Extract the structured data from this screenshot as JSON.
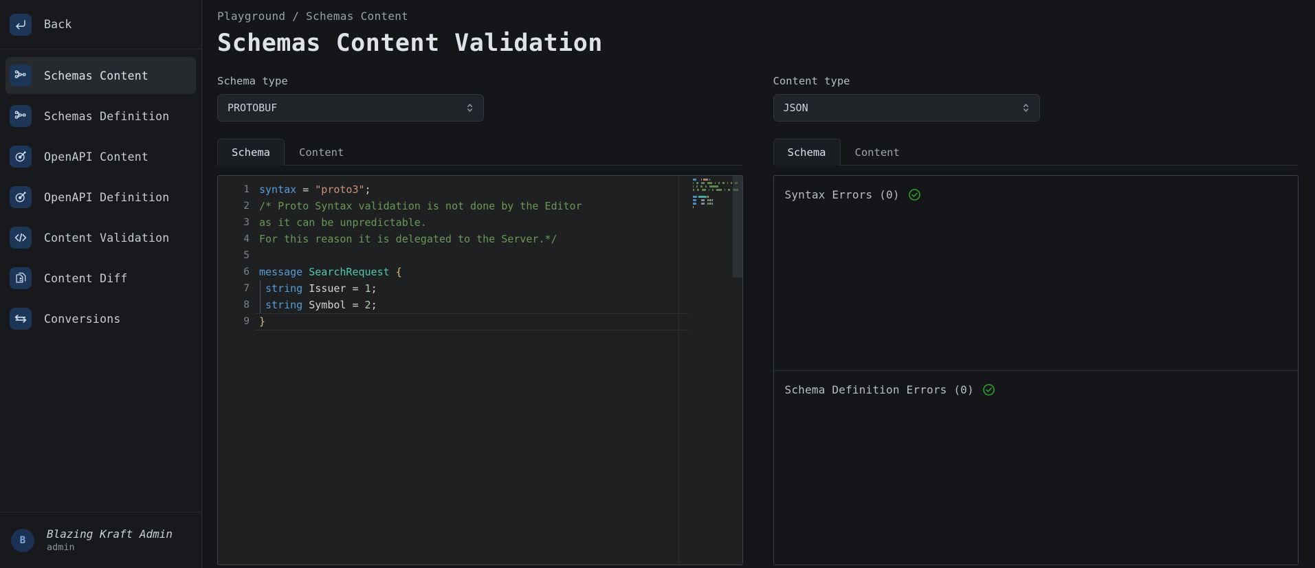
{
  "sidebar": {
    "back": {
      "label": "Back",
      "icon": "back-arrow-icon"
    },
    "items": [
      {
        "label": "Schemas Content",
        "icon": "schema-node-icon",
        "active": true
      },
      {
        "label": "Schemas Definition",
        "icon": "schema-node-icon",
        "active": false
      },
      {
        "label": "OpenAPI Content",
        "icon": "openapi-icon",
        "active": false
      },
      {
        "label": "OpenAPI Definition",
        "icon": "openapi-icon",
        "active": false
      },
      {
        "label": "Content Validation",
        "icon": "code-brackets-icon",
        "active": false
      },
      {
        "label": "Content Diff",
        "icon": "document-diff-icon",
        "active": false
      },
      {
        "label": "Conversions",
        "icon": "swap-arrows-icon",
        "active": false
      }
    ],
    "user": {
      "initial": "B",
      "name": "Blazing Kraft Admin",
      "role": "admin"
    }
  },
  "header": {
    "breadcrumb": "Playground / Schemas Content",
    "title": "Schemas Content Validation"
  },
  "left": {
    "select_label": "Schema type",
    "select_value": "PROTOBUF",
    "tabs": [
      {
        "label": "Schema",
        "active": true
      },
      {
        "label": "Content",
        "active": false
      }
    ],
    "editor": {
      "language": "protobuf",
      "lines": [
        {
          "n": "1",
          "tokens": [
            {
              "t": "syntax",
              "c": "tok-key"
            },
            {
              "t": " = ",
              "c": "tok-plain"
            },
            {
              "t": "\"proto3\"",
              "c": "tok-str"
            },
            {
              "t": ";",
              "c": "tok-plain"
            }
          ]
        },
        {
          "n": "2",
          "tokens": [
            {
              "t": "/* Proto Syntax validation is not done by the Editor",
              "c": "tok-cmt"
            }
          ]
        },
        {
          "n": "3",
          "tokens": [
            {
              "t": "as it can be unpredictable.",
              "c": "tok-cmt"
            }
          ]
        },
        {
          "n": "4",
          "tokens": [
            {
              "t": "For this reason it is delegated to the Server.*/",
              "c": "tok-cmt"
            }
          ]
        },
        {
          "n": "5",
          "tokens": [
            {
              "t": "",
              "c": "tok-plain"
            }
          ]
        },
        {
          "n": "6",
          "tokens": [
            {
              "t": "message ",
              "c": "tok-key"
            },
            {
              "t": "SearchRequest",
              "c": "tok-cls"
            },
            {
              "t": " ",
              "c": "tok-plain"
            },
            {
              "t": "{",
              "c": "tok-brace"
            }
          ]
        },
        {
          "n": "7",
          "tokens": [
            {
              "t": " ",
              "c": "tok-plain"
            },
            {
              "t": "string",
              "c": "tok-key"
            },
            {
              "t": " Issuer = ",
              "c": "tok-plain"
            },
            {
              "t": "1",
              "c": "tok-num"
            },
            {
              "t": ";",
              "c": "tok-plain"
            }
          ]
        },
        {
          "n": "8",
          "tokens": [
            {
              "t": " ",
              "c": "tok-plain"
            },
            {
              "t": "string",
              "c": "tok-key"
            },
            {
              "t": " Symbol = ",
              "c": "tok-plain"
            },
            {
              "t": "2",
              "c": "tok-num"
            },
            {
              "t": ";",
              "c": "tok-plain"
            }
          ]
        },
        {
          "n": "9",
          "tokens": [
            {
              "t": "}",
              "c": "tok-brace"
            }
          ]
        }
      ]
    }
  },
  "right": {
    "select_label": "Content type",
    "select_value": "JSON",
    "tabs": [
      {
        "label": "Schema",
        "active": true
      },
      {
        "label": "Content",
        "active": false
      }
    ],
    "panels": [
      {
        "title": "Syntax Errors (0)",
        "status": "ok",
        "icon": "check-circle-icon"
      },
      {
        "title": "Schema Definition Errors (0)",
        "status": "ok",
        "icon": "check-circle-icon"
      }
    ]
  },
  "colors": {
    "page_bg": "#141619",
    "sidebar_bg": "#17191c",
    "accent_icon_bg": "#1d3557",
    "accent_icon_fg": "#cfe0f5",
    "editor_bg": "#1e2022",
    "border": "#3b4250",
    "ok_green": "#2a9e2a",
    "text_primary": "#dfe3e9",
    "text_muted": "#9aa0a8"
  }
}
